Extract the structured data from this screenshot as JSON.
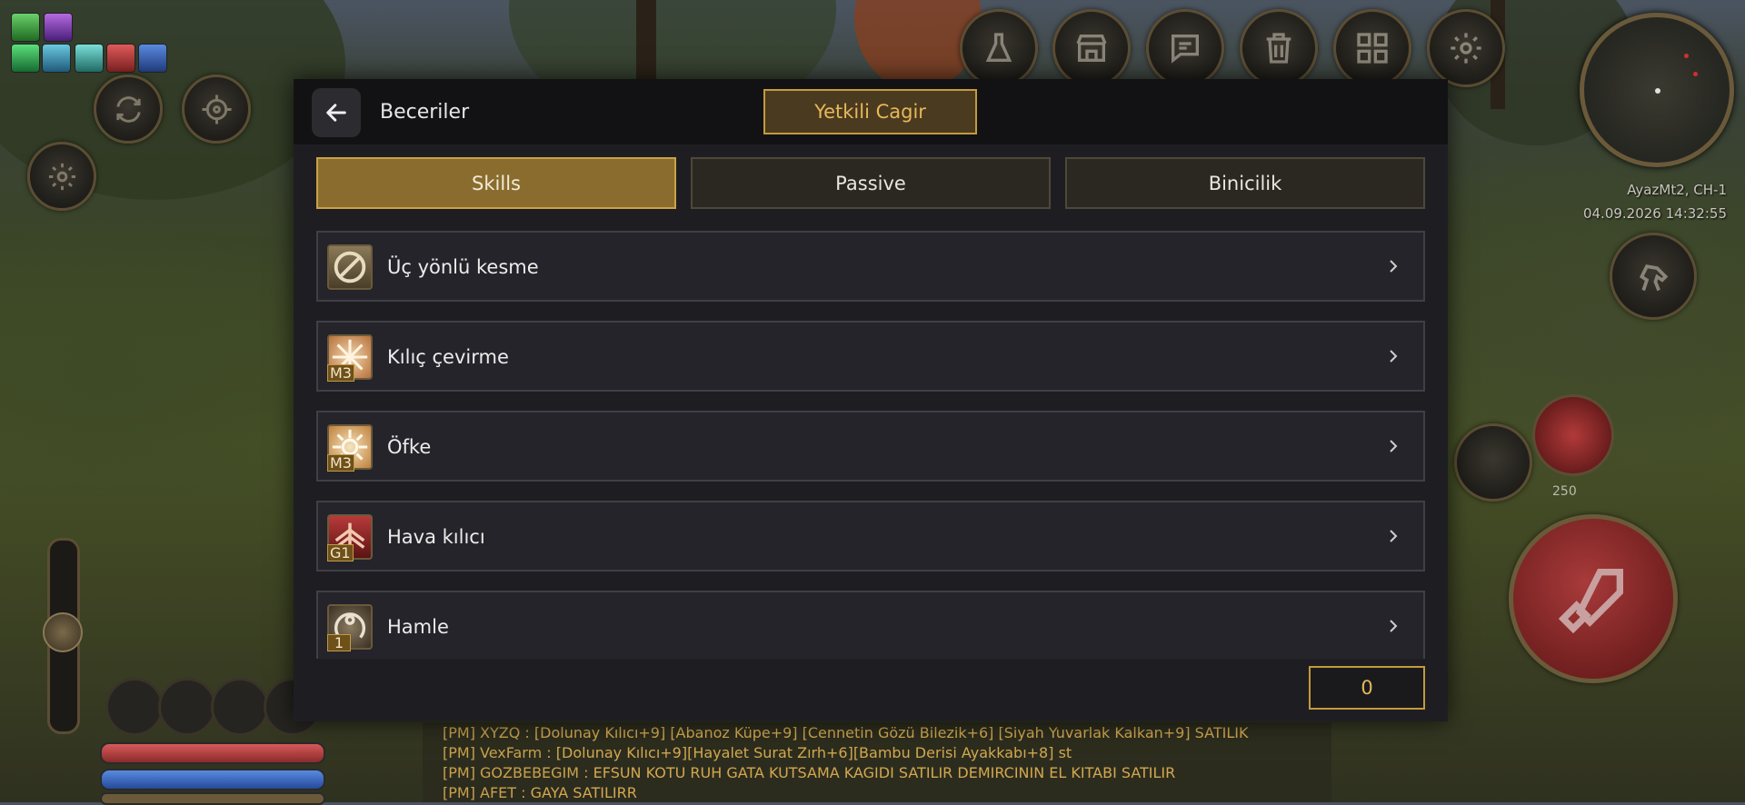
{
  "background": {
    "server_label": "AyazMt2, CH-1",
    "datetime": "04.09.2026 14:32:55",
    "potion_count": "250",
    "colors": {
      "accent": "#c49a3c",
      "hp": "#b23a3a",
      "sp": "#2f5fc4"
    }
  },
  "chat": {
    "lines": [
      {
        "pm": "[PM]",
        "name": "XYZQ :",
        "msg": "[Dolunay Kılıcı+9] [Abanoz Küpe+9] [Cennetin Gözü Bilezik+6] [Siyah Yuvarlak Kalkan+9] SATILIK"
      },
      {
        "pm": "[PM]",
        "name": "VexFarm :",
        "msg": "[Dolunay Kılıcı+9][Hayalet Surat Zırh+6][Bambu Derisi Ayakkabı+8] st"
      },
      {
        "pm": "[PM]",
        "name": "GOZBEBEGIM :",
        "msg": "EFSUN KOTU RUH GATA KUTSAMA KAGIDI SATILIR DEMIRCININ EL KITABI SATILIR"
      },
      {
        "pm": "[PM]",
        "name": "AFET :",
        "msg": "GAYA SATILIRR"
      }
    ]
  },
  "dialog": {
    "title": "Beceriler",
    "gm_button": "Yetkili Cagir",
    "tabs": [
      {
        "label": "Skills",
        "active": true
      },
      {
        "label": "Passive",
        "active": false
      },
      {
        "label": "Binicilik",
        "active": false
      }
    ],
    "skills": [
      {
        "name": "Üç yönlü kesme",
        "badge": "",
        "icon": "three-way-cut-icon"
      },
      {
        "name": "Kılıç çevirme",
        "badge": "M3",
        "icon": "sword-spin-icon"
      },
      {
        "name": "Öfke",
        "badge": "M3",
        "icon": "berserk-icon"
      },
      {
        "name": "Hava kılıcı",
        "badge": "G1",
        "icon": "aura-sword-icon"
      },
      {
        "name": "Hamle",
        "badge": "1",
        "icon": "dash-icon"
      }
    ],
    "skill_points": "0"
  }
}
